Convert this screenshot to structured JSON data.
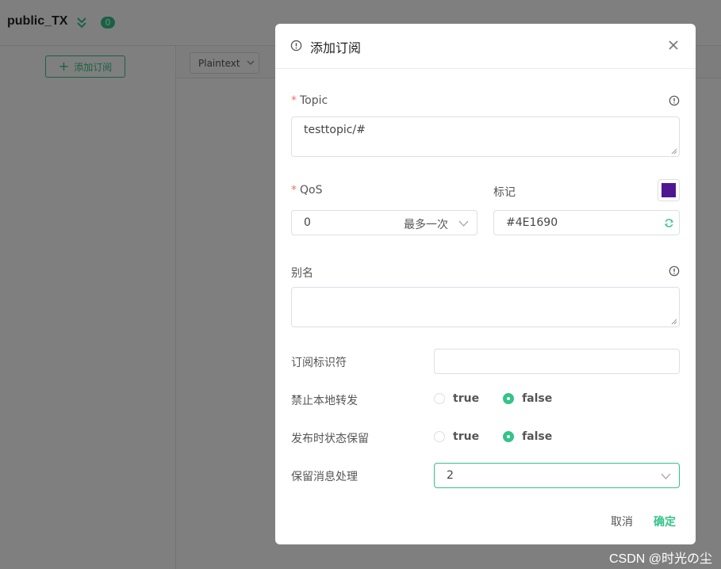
{
  "app": {
    "connection_name": "public_TX",
    "subscription_count": "0",
    "add_subscription_label": "添加订阅",
    "payload_format": "Plaintext"
  },
  "dialog": {
    "title": "添加订阅",
    "topic": {
      "required": "*",
      "label": "Topic",
      "value": "testtopic/#"
    },
    "qos": {
      "required": "*",
      "label": "QoS",
      "value": "0",
      "description": "最多一次"
    },
    "color": {
      "label": "标记",
      "value": "#4E1690",
      "swatch_color": "#4E1690"
    },
    "alias": {
      "label": "别名",
      "value": ""
    },
    "subscription_identifier": {
      "label": "订阅标识符",
      "value": ""
    },
    "no_local": {
      "label": "禁止本地转发",
      "options": [
        "true",
        "false"
      ],
      "selected": "false"
    },
    "retain_as_published": {
      "label": "发布时状态保留",
      "options": [
        "true",
        "false"
      ],
      "selected": "false"
    },
    "retain_handling": {
      "label": "保留消息处理",
      "value": "2"
    },
    "cancel_label": "取消",
    "confirm_label": "确定"
  },
  "watermark": "CSDN @时光の尘",
  "colors": {
    "accent": "#34c388",
    "required": "#f56c6c"
  }
}
